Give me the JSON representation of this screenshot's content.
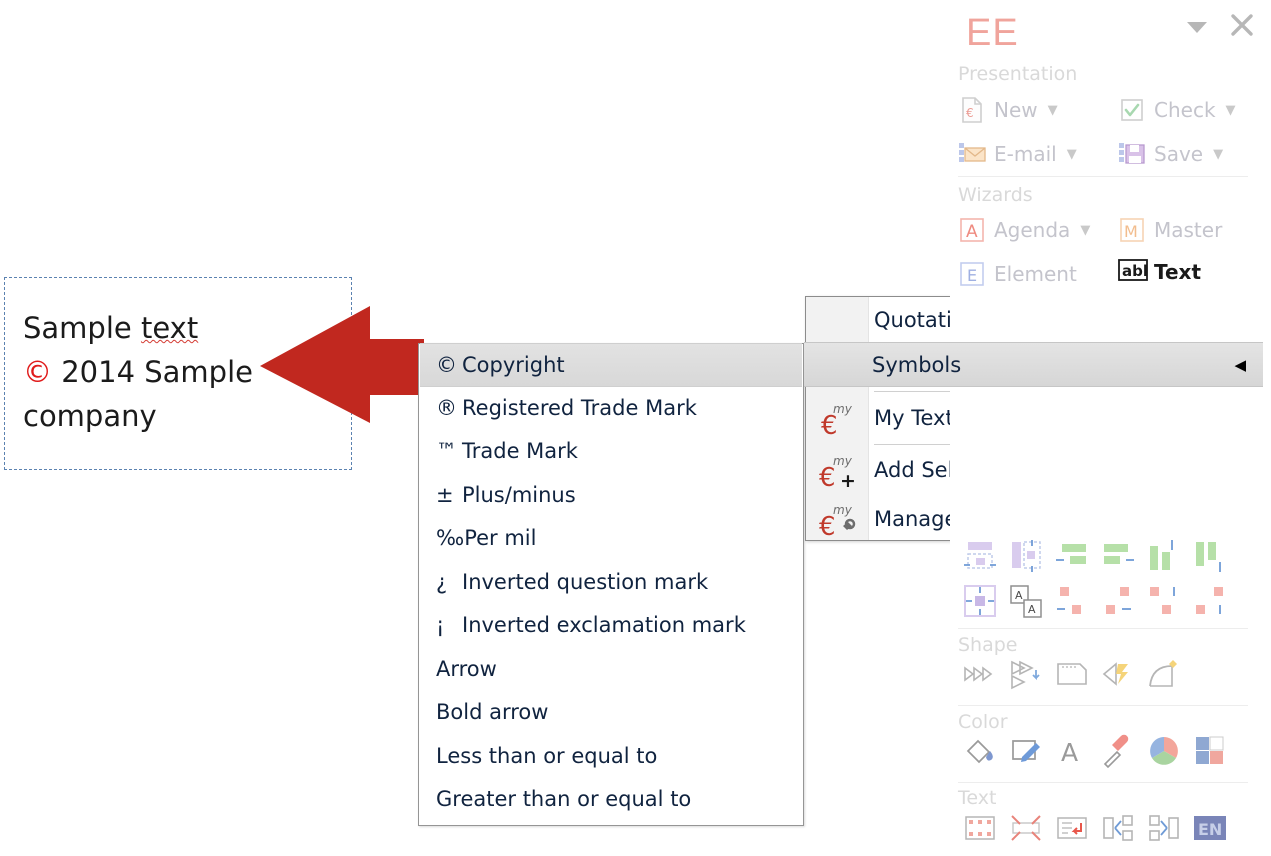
{
  "slide": {
    "textbox": {
      "line1": "Sample text",
      "line2_symbol": "©",
      "line2_rest": " 2014 Sample",
      "line3": "company"
    },
    "arrow": {
      "name": "red-left-arrow",
      "color": "#c1281f"
    }
  },
  "symbols_menu": {
    "items": [
      {
        "glyph": "©",
        "label": "Copyright",
        "selected": true
      },
      {
        "glyph": "®",
        "label": "Registered Trade Mark",
        "selected": false
      },
      {
        "glyph": "™",
        "label": "Trade Mark",
        "selected": false
      },
      {
        "glyph": "±",
        "label": "Plus/minus",
        "selected": false
      },
      {
        "glyph": "‰",
        "label": "Per mil",
        "selected": false
      },
      {
        "glyph": "¿",
        "label": "Inverted question mark",
        "selected": false
      },
      {
        "glyph": "¡",
        "label": "Inverted exclamation mark",
        "selected": false
      },
      {
        "glyph": "",
        "label": "Arrow",
        "selected": false
      },
      {
        "glyph": "",
        "label": "Bold arrow",
        "selected": false
      },
      {
        "glyph": "",
        "label": "Less than or equal to",
        "selected": false
      },
      {
        "glyph": "",
        "label": "Greater than or equal to",
        "selected": false
      }
    ]
  },
  "context_menu": {
    "items": [
      {
        "label": "Quotations",
        "submenu_arrow": "◀",
        "has_icon": false,
        "highlighted": false
      },
      {
        "label": "Symbols",
        "submenu_arrow": "◀",
        "has_icon": false,
        "highlighted": true
      },
      {
        "label": "My Texts",
        "submenu_arrow": "◀",
        "has_icon": true,
        "icon": "my-euro-icon",
        "highlighted": false
      },
      {
        "label": "Add Selection to \"My Texts\"...",
        "submenu_arrow": "",
        "has_icon": true,
        "icon": "my-euro-plus-icon",
        "highlighted": false
      },
      {
        "label": "Manage \"My Texts\"...",
        "submenu_arrow": "",
        "has_icon": true,
        "icon": "my-euro-manage-icon",
        "highlighted": false
      }
    ]
  },
  "toolbar": {
    "logo": "EE",
    "collapse_icon": "▼",
    "close_icon": "✕",
    "groups": [
      {
        "label": "Presentation",
        "entries": [
          {
            "label": "New",
            "icon": "new-document-icon",
            "caret": "▼",
            "active": false
          },
          {
            "label": "Check",
            "icon": "check-box-icon",
            "caret": "▼",
            "active": false
          },
          {
            "label": "E-mail",
            "icon": "email-envelope-icon",
            "caret": "▼",
            "active": false
          },
          {
            "label": "Save",
            "icon": "save-floppy-icon",
            "caret": "▼",
            "active": false
          }
        ]
      },
      {
        "label": "Wizards",
        "entries": [
          {
            "label": "Agenda",
            "icon": "agenda-a-icon",
            "caret": "▼",
            "active": false
          },
          {
            "label": "Master",
            "icon": "master-m-icon",
            "caret": "",
            "active": false
          },
          {
            "label": "Element",
            "icon": "element-e-icon",
            "caret": "",
            "active": false
          },
          {
            "label": "Text",
            "icon": "abl-text-icon",
            "caret": "",
            "active": true
          }
        ]
      },
      {
        "label": "Shape",
        "entries": []
      },
      {
        "label": "Color",
        "entries": []
      },
      {
        "label": "Text",
        "entries": []
      }
    ],
    "align_icons_row1": [
      "align-bottom-icon",
      "align-middle-vertical-icon",
      "align-left-green-icon",
      "align-right-green-icon",
      "align-top-green-icon",
      "distribute-vertical-green-icon"
    ],
    "align_icons_row2": [
      "expand-all-icon",
      "swap-objects-icon",
      "move-left-red-icon",
      "move-right-red-icon",
      "move-up-red-icon",
      "move-down-red-icon"
    ],
    "shape_icons": [
      "merge-shapes-icon",
      "subtract-shapes-icon",
      "shape-style-icon",
      "fragment-shape-icon",
      "curve-shape-icon"
    ],
    "color_icons": [
      "fill-bucket-icon",
      "edit-pen-icon",
      "font-color-icon",
      "eyedropper-icon",
      "color-wheel-icon",
      "color-swap-icon"
    ],
    "text_icons": [
      "text-frame-icon",
      "text-fit-icon",
      "text-wrap-icon",
      "text-split-icon",
      "text-merge-icon",
      "language-en-icon"
    ],
    "language_badge": "EN",
    "accent_colors": {
      "logo": "#f0a49c",
      "copyright_red": "#e01b1b",
      "arrow_red": "#c1281f",
      "language_badge_bg": "#7a85b8"
    }
  }
}
